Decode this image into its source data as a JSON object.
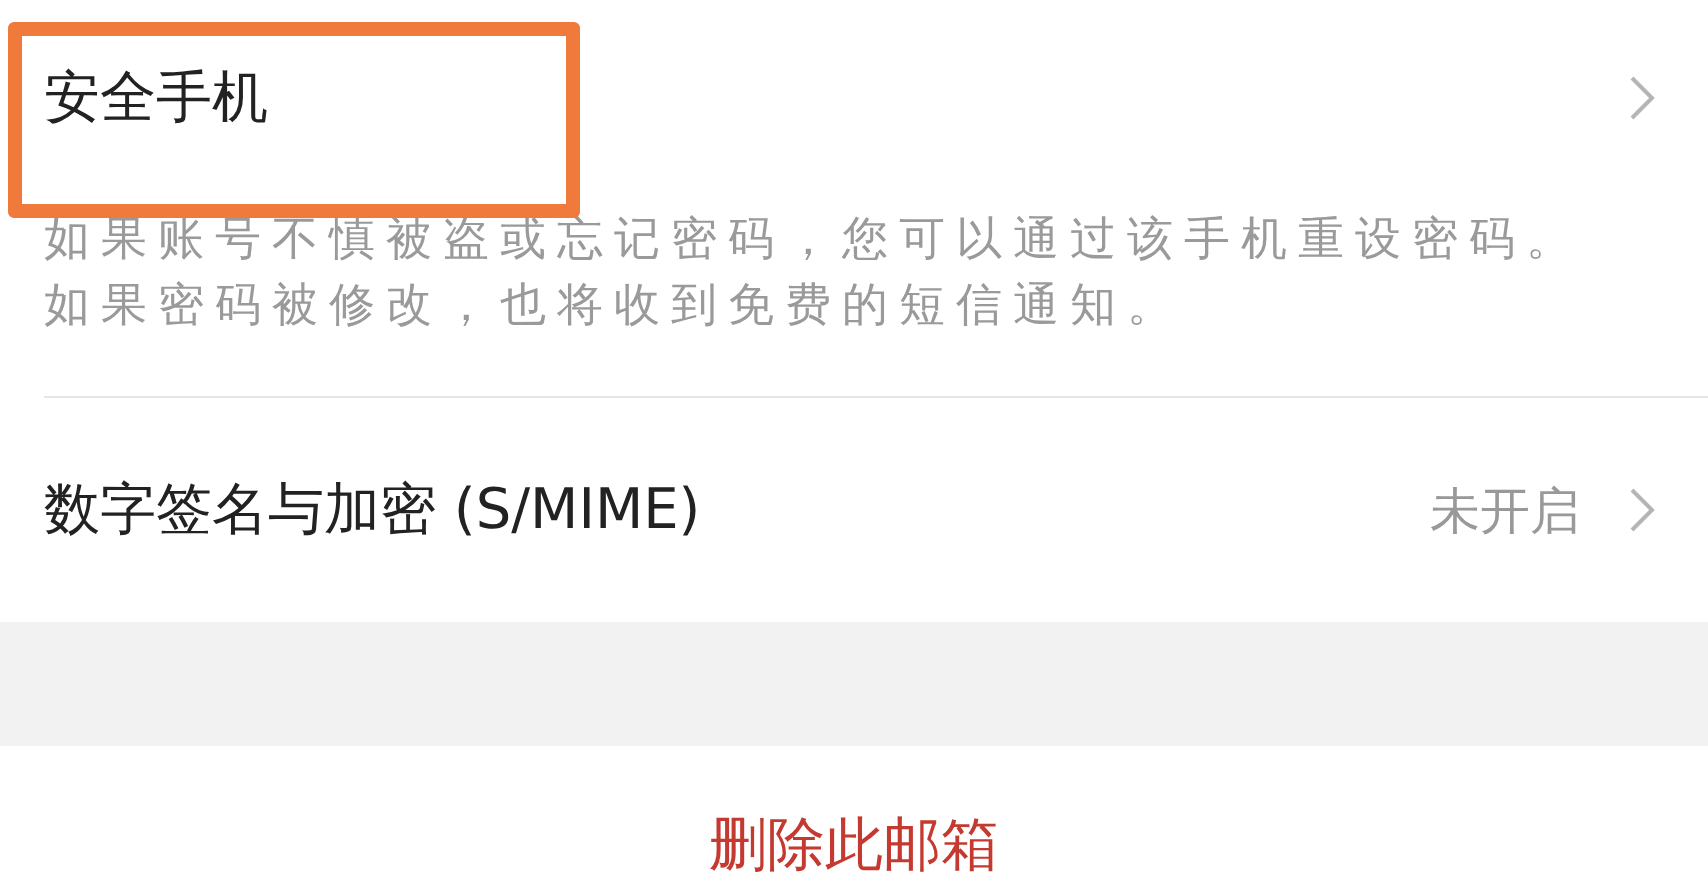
{
  "items": [
    {
      "title": "安全手机",
      "description": "如果账号不慎被盗或忘记密码，您可以通过该手机重设密码。如果密码被修改，也将收到免费的短信通知。",
      "highlighted": true
    },
    {
      "title": "数字签名与加密 (S/MIME)",
      "value": "未开启",
      "highlighted": false
    }
  ],
  "delete_button": {
    "label": "删除此邮箱"
  }
}
